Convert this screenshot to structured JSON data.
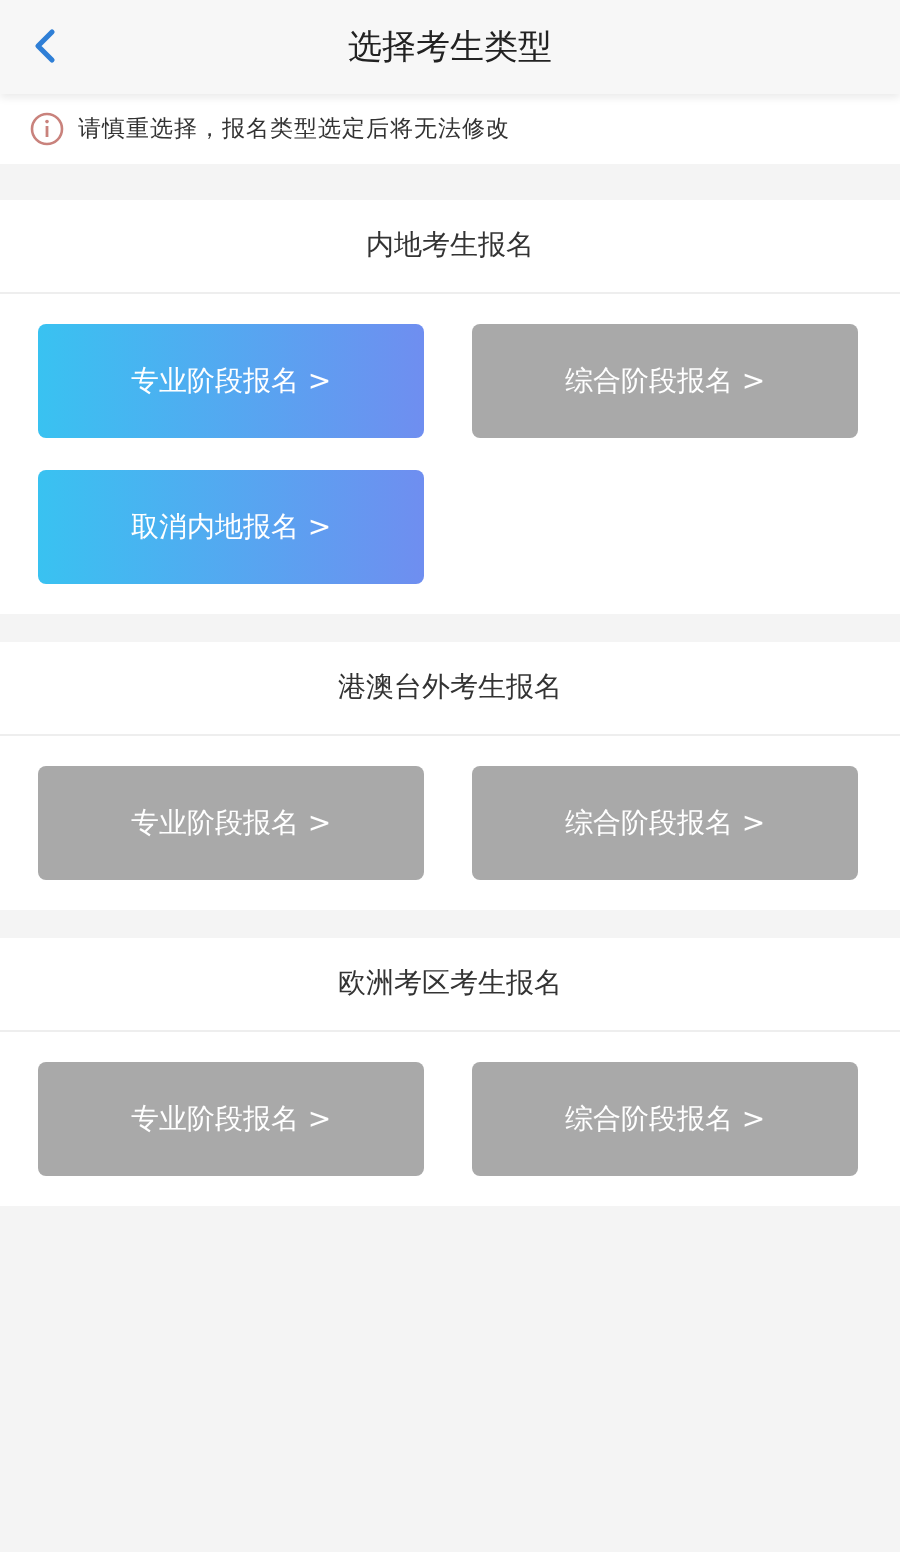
{
  "header": {
    "title": "选择考生类型"
  },
  "notice": "请慎重选择，报名类型选定后将无法修改",
  "sections": [
    {
      "title": "内地考生报名",
      "buttons": [
        {
          "label": "专业阶段报名 >",
          "disabled": false
        },
        {
          "label": "综合阶段报名 >",
          "disabled": true
        },
        {
          "label": "取消内地报名 >",
          "disabled": false
        }
      ]
    },
    {
      "title": "港澳台外考生报名",
      "buttons": [
        {
          "label": "专业阶段报名 >",
          "disabled": true
        },
        {
          "label": "综合阶段报名 >",
          "disabled": true
        }
      ]
    },
    {
      "title": "欧洲考区考生报名",
      "buttons": [
        {
          "label": "专业阶段报名 >",
          "disabled": true
        },
        {
          "label": "综合阶段报名 >",
          "disabled": true
        }
      ]
    }
  ]
}
